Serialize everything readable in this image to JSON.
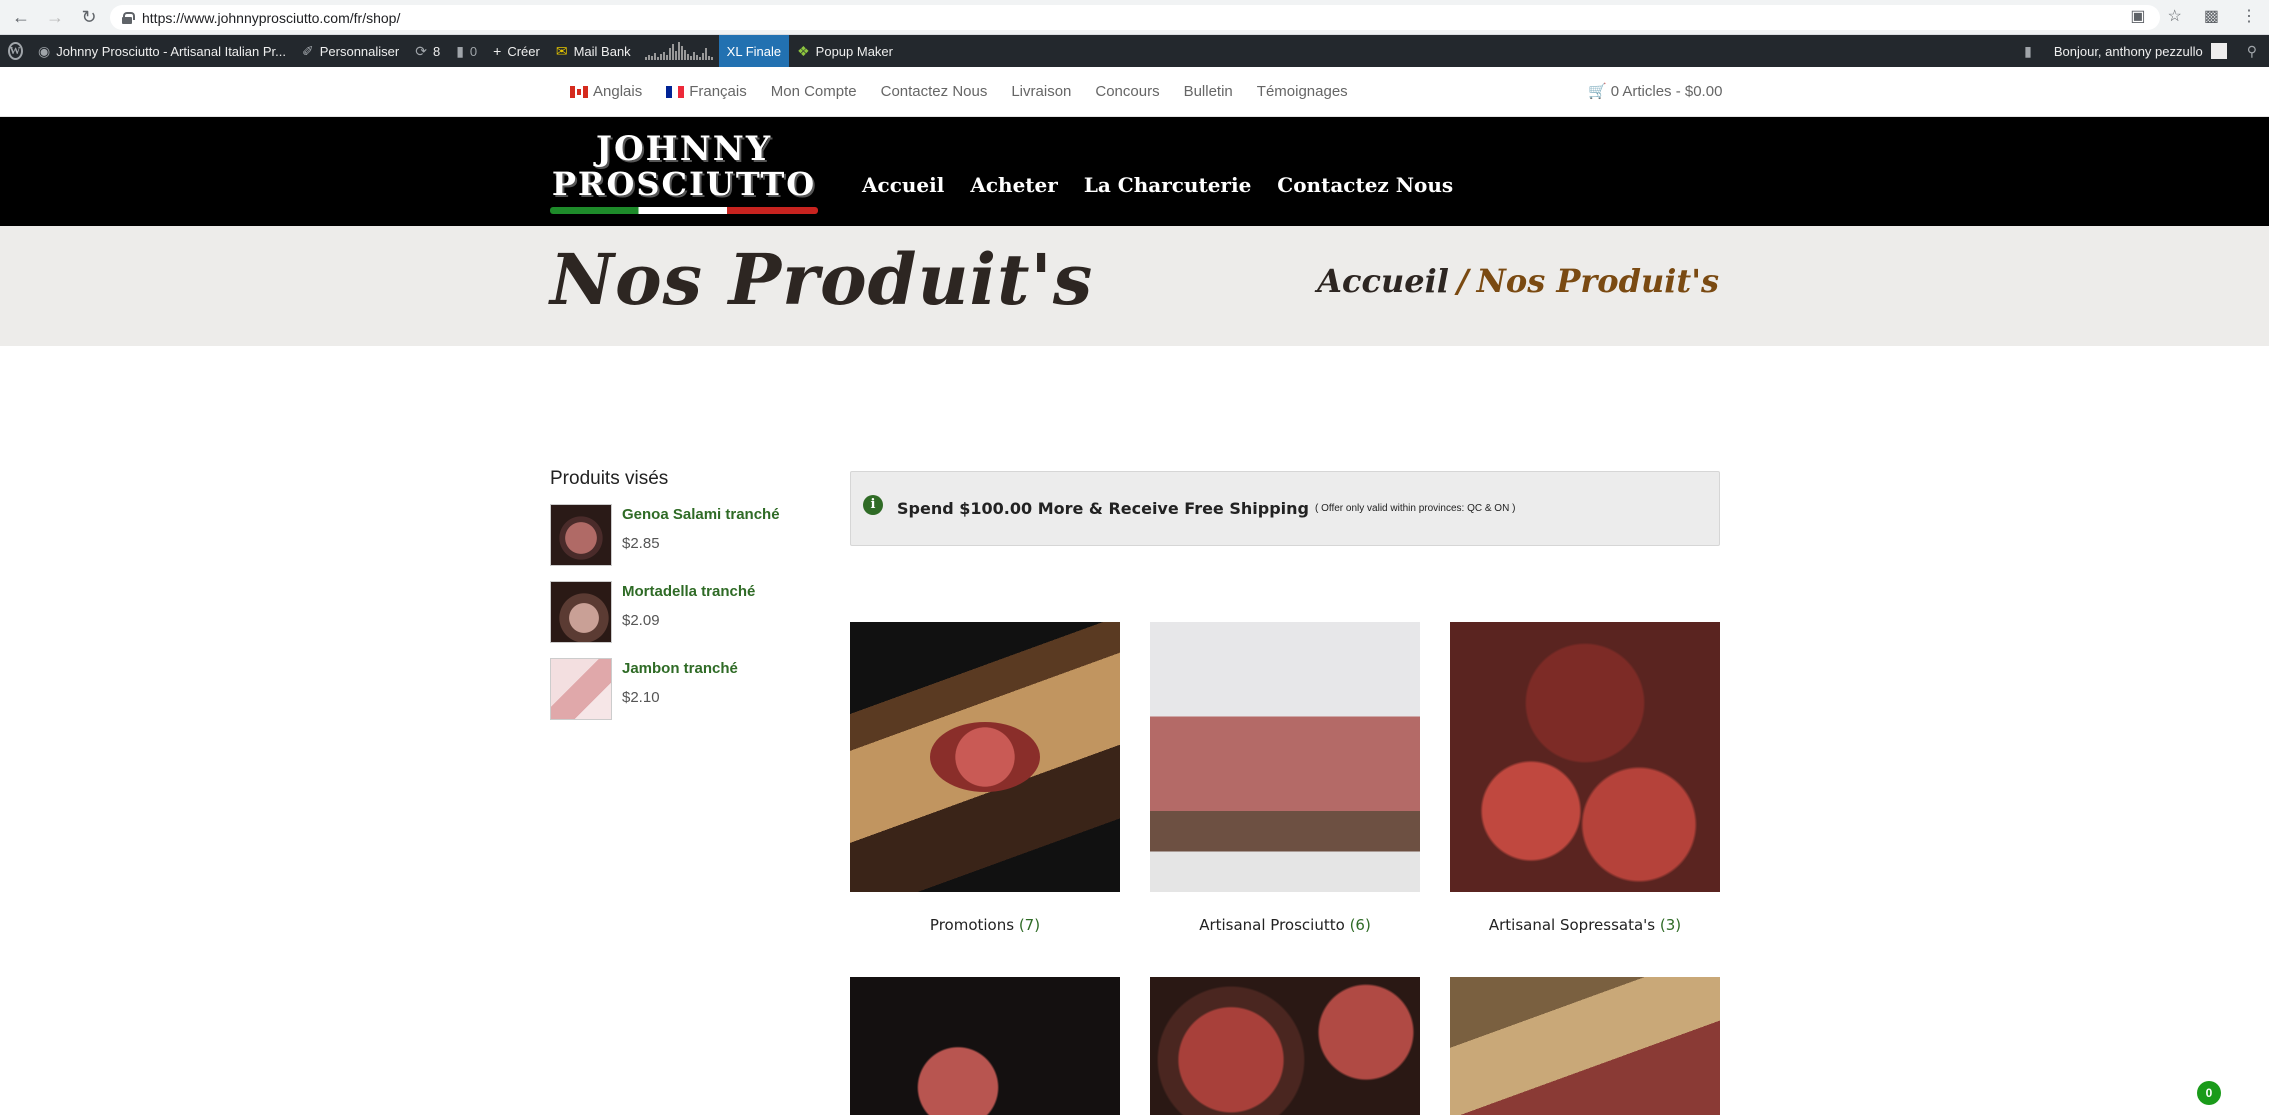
{
  "browser": {
    "url": "https://www.johnnyprosciutto.com/fr/shop/"
  },
  "adminbar": {
    "site_name": "Johnny Prosciutto - Artisanal Italian Pr...",
    "customize": "Personnaliser",
    "updates_count": "8",
    "comments_count": "0",
    "create": "Créer",
    "mail_bank": "Mail Bank",
    "xl_finale": "XL Finale",
    "popup_maker": "Popup Maker",
    "greeting": "Bonjour, anthony pezzullo"
  },
  "topnav": {
    "links": [
      "Anglais",
      "Français",
      "Mon Compte",
      "Contactez Nous",
      "Livraison",
      "Concours",
      "Bulletin",
      "Témoignages"
    ],
    "cart": "0 Articles - $0.00"
  },
  "header": {
    "logo_line1": "JOHNNY",
    "logo_line2": "PROSCIUTTO",
    "menu": [
      "Accueil",
      "Acheter",
      "La Charcuterie",
      "Contactez Nous"
    ]
  },
  "titleband": {
    "title": "Nos Produit's",
    "crumb_home": "Accueil",
    "crumb_sep": "/",
    "crumb_current": "Nos Produit's"
  },
  "sidebar": {
    "heading": "Produits visés",
    "products": [
      {
        "name": "Genoa Salami tranché",
        "price": "$2.85"
      },
      {
        "name": "Mortadella tranché",
        "price": "$2.09"
      },
      {
        "name": "Jambon tranché",
        "price": "$2.10"
      }
    ]
  },
  "notice": {
    "main": "Spend $100.00 More & Receive Free Shipping",
    "small": "( Offer only valid within provinces: QC & ON )"
  },
  "categories": [
    {
      "name": "Promotions",
      "count": "(7)"
    },
    {
      "name": "Artisanal Prosciutto",
      "count": "(6)"
    },
    {
      "name": "Artisanal Sopressata's",
      "count": "(3)"
    }
  ],
  "badge": "0"
}
